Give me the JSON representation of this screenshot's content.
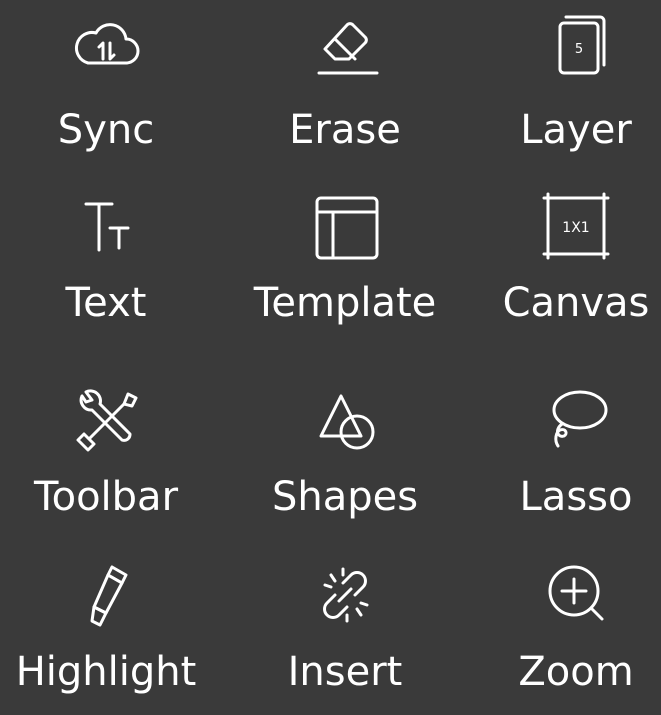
{
  "tools": [
    {
      "label": "Sync",
      "icon": "cloud-sync-icon"
    },
    {
      "label": "Erase",
      "icon": "eraser-icon"
    },
    {
      "label": "Layer",
      "icon": "layers-icon",
      "badge": "5"
    },
    {
      "label": "Text",
      "icon": "text-size-icon"
    },
    {
      "label": "Template",
      "icon": "template-icon"
    },
    {
      "label": "Canvas",
      "icon": "canvas-icon",
      "badge": "1X1"
    },
    {
      "label": "Toolbar",
      "icon": "wrench-screwdriver-icon"
    },
    {
      "label": "Shapes",
      "icon": "shapes-icon"
    },
    {
      "label": "Lasso",
      "icon": "lasso-icon"
    },
    {
      "label": "Highlight",
      "icon": "highlighter-icon"
    },
    {
      "label": "Insert",
      "icon": "insert-link-icon"
    },
    {
      "label": "Zoom",
      "icon": "zoom-in-icon"
    }
  ],
  "colors": {
    "background": "#3a3a3a",
    "foreground": "#ffffff"
  }
}
